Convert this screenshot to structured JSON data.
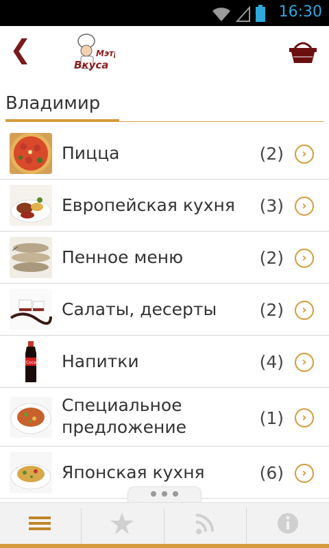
{
  "status": {
    "time": "16:30",
    "battery_level": 0.9,
    "wifi": "wifi-icon",
    "signal": "no-signal-icon"
  },
  "header": {
    "logo_text": "Мэтр Вкуса",
    "back_icon": "back-chevron-icon",
    "basket_icon": "basket-icon"
  },
  "city": {
    "name": "Владимир"
  },
  "categories": [
    {
      "label": "Пицца",
      "count": "(2)",
      "icon": "pizza-thumb"
    },
    {
      "label": "Европейская кухня",
      "count": "(3)",
      "icon": "european-dish-thumb"
    },
    {
      "label": "Пенное меню",
      "count": "(2)",
      "icon": "fish-thumb"
    },
    {
      "label": "Салаты, десерты",
      "count": "(2)",
      "icon": "dessert-thumb"
    },
    {
      "label": "Напитки",
      "count": "(4)",
      "icon": "cola-thumb"
    },
    {
      "label": "Специальное предложение",
      "label_line1": "Специальное",
      "label_line2": "предложение",
      "count": "(1)",
      "icon": "special-dish-thumb"
    },
    {
      "label": "Японская кухня",
      "count": "(6)",
      "icon": "japanese-dish-thumb"
    }
  ],
  "bottom_nav": [
    {
      "name": "menu",
      "icon": "menu-icon",
      "active": true
    },
    {
      "name": "favorites",
      "icon": "star-icon",
      "active": false
    },
    {
      "name": "feed",
      "icon": "rss-icon",
      "active": false
    },
    {
      "name": "info",
      "icon": "info-icon",
      "active": false
    }
  ],
  "colors": {
    "accent": "#d59a3c",
    "brand_dark": "#7a1a1a",
    "status_blue": "#2fa8dc"
  }
}
